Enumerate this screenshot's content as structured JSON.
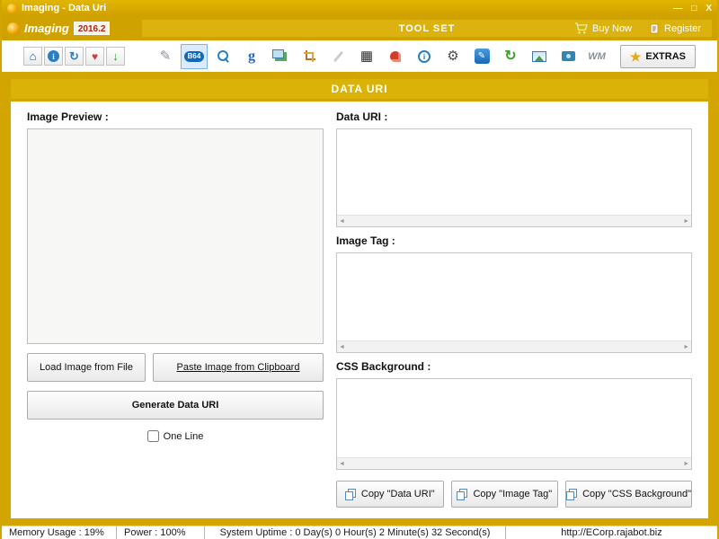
{
  "colors": {
    "gold": "#D2A500",
    "gold_strip": "#DCB30E",
    "banner_gold": "#DBB307",
    "selected_tool_bg": "#DBEAFC",
    "accent_blue": "#1468B8"
  },
  "window": {
    "title": "Imaging - Data Uri",
    "minimize": "—",
    "maximize": "□",
    "close": "X"
  },
  "header": {
    "app_name": "Imaging",
    "version": "2016.2",
    "toolset_label": "TOOL SET",
    "buy_now_label": "Buy Now",
    "register_label": "Register"
  },
  "toolbar": {
    "b64_label": "B64",
    "google_label": "g",
    "watermark_label": "WM",
    "extras_label": "EXTRAS",
    "selected_tool": "base64-encoder"
  },
  "icons": {
    "home": "⌂",
    "about": "i",
    "sync": "↻",
    "favorite": "♥",
    "download": "↓",
    "pen": "✎",
    "grid": "▦",
    "info": "i",
    "gear": "⚙",
    "edit": "✎",
    "refresh": "↻",
    "star": "★",
    "scroll_left": "◄",
    "scroll_right": "►"
  },
  "banner": {
    "title": "DATA URI"
  },
  "left_panel": {
    "preview_label": "Image Preview :",
    "load_button": "Load Image from File",
    "paste_button": "Paste Image from Clipboard",
    "generate_button": "Generate Data URI",
    "one_line_label": "One Line",
    "one_line_checked": false
  },
  "right_panel": {
    "data_uri_label": "Data URI :",
    "data_uri_value": "",
    "image_tag_label": "Image Tag :",
    "image_tag_value": "",
    "css_background_label": "CSS Background :",
    "css_background_value": "",
    "copy_data_uri_button": "Copy \"Data URI\"",
    "copy_image_tag_button": "Copy \"Image Tag\"",
    "copy_css_background_button": "Copy \"CSS Background\""
  },
  "status_bar": {
    "memory": "Memory Usage : 19%",
    "power": "Power : 100%",
    "uptime": "System Uptime : 0 Day(s) 0 Hour(s) 2 Minute(s) 32 Second(s)",
    "url": "http://ECorp.rajabot.biz"
  }
}
